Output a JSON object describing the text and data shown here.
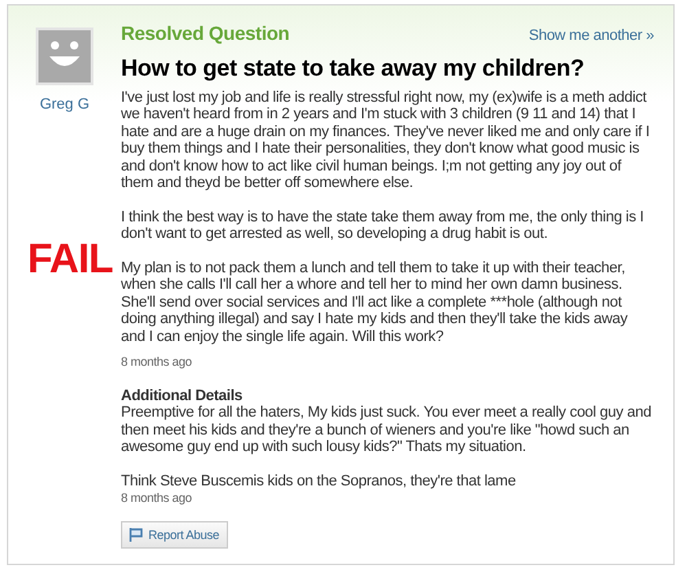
{
  "status": "Resolved Question",
  "show_another": "Show me another »",
  "user": {
    "name": "Greg G"
  },
  "stamp": "FAIL",
  "question": {
    "title": "How to get state to take away my children?",
    "paragraphs": [
      "I've just lost my job and life is really stressful right now, my (ex)wife is a meth addict we haven't heard from in 2 years and I'm stuck with 3 children (9 11 and 14) that I hate and are a huge drain on my finances. They've never liked me and only care if I buy them things and I hate their personalities, they don't know what good music is and don't know how to act like civil human beings. I;m not getting any joy out of them and theyd be better off somewhere else.",
      "I think the best way is to have the state take them away from me, the only thing is I don't want to get arrested as well, so developing a drug habit is out.",
      "My plan is to not pack them a lunch and tell them to take it up with their teacher, when she calls I'll call her a whore and tell her to mind her own damn business. She'll send over social services and I'll act like a complete ***hole (although not doing anything illegal) and say I hate my kids and then they'll take the kids away and I can enjoy the single life again. Will this work?"
    ],
    "time": "8 months ago"
  },
  "additional": {
    "heading": "Additional Details",
    "paragraphs": [
      "Preemptive for all the haters, My kids just suck. You ever meet a really cool guy and then meet his kids and they're a bunch of wieners and you're like \"howd such an awesome guy end up with such lousy kids?\" Thats my situation.",
      "Think Steve Buscemis kids on the Sopranos, they're that lame"
    ],
    "time": "8 months ago"
  },
  "report_button": "Report Abuse"
}
